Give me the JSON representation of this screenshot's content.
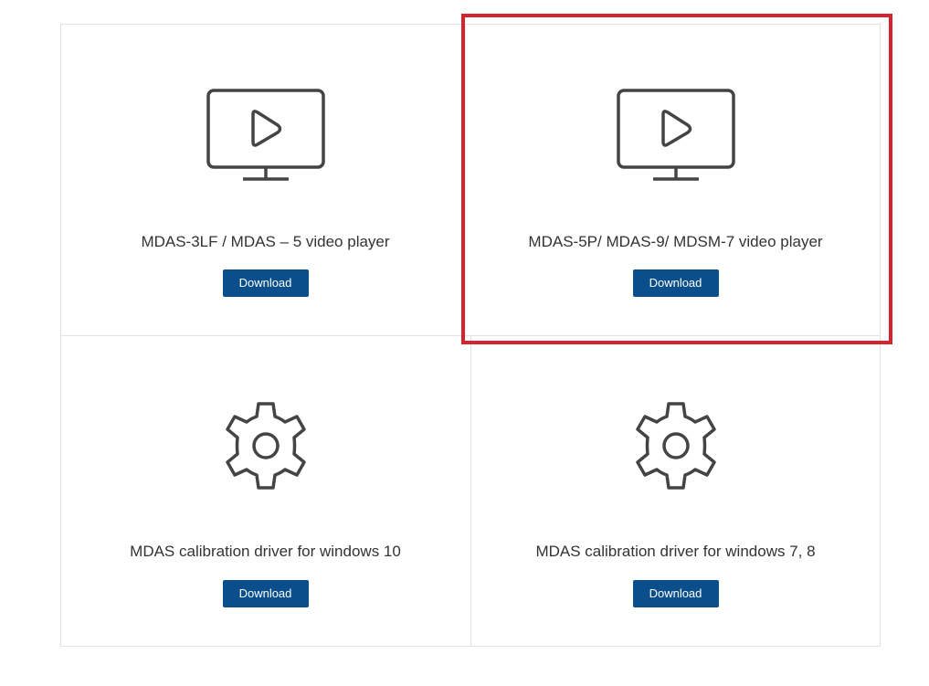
{
  "cards": [
    {
      "icon": "monitor-play-icon",
      "title": "MDAS-3LF / MDAS – 5 video player",
      "button_label": "Download"
    },
    {
      "icon": "monitor-play-icon",
      "title": "MDAS-5P/ MDAS-9/ MDSM-7 video player",
      "button_label": "Download"
    },
    {
      "icon": "gear-icon",
      "title": "MDAS calibration driver for windows 10",
      "button_label": "Download"
    },
    {
      "icon": "gear-icon",
      "title": "MDAS calibration driver for windows 7, 8",
      "button_label": "Download"
    }
  ],
  "colors": {
    "button_bg": "#0a4f8c",
    "button_text": "#ffffff",
    "highlight": "#d7232e",
    "border": "#e1e1e1",
    "text": "#333333",
    "icon_stroke": "#444444"
  }
}
